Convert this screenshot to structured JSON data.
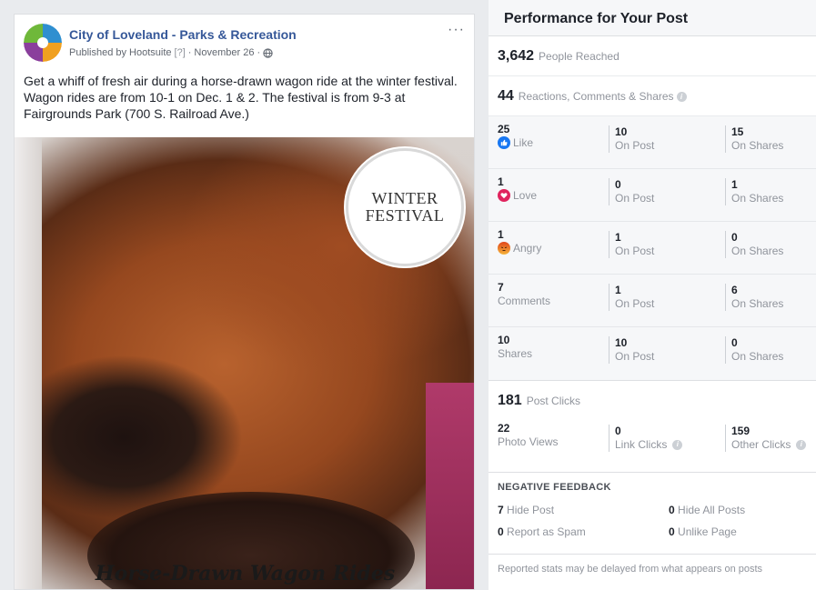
{
  "post": {
    "page_name": "City of Loveland - Parks & Recreation",
    "published_by": "Published by Hootsuite",
    "help_mark": "[?]",
    "date": "November 26",
    "more": "···",
    "text": "Get a whiff of fresh air during a horse-drawn wagon ride at the winter festival. Wagon rides are from 10-1 on Dec. 1 & 2. The festival is from 9-3 at Fairgrounds Park (700 S. Railroad Ave.)",
    "image": {
      "badge_line1": "WINTER",
      "badge_line2": "FESTIVAL",
      "caption": "Horse-Drawn Wagon Rides"
    }
  },
  "panel": {
    "title": "Performance for Your Post",
    "reach": {
      "value": "3,642",
      "label": "People Reached"
    },
    "engagement": {
      "value": "44",
      "label": "Reactions, Comments & Shares"
    },
    "stats": [
      {
        "value": "25",
        "label": "Like",
        "icon": "like-icon",
        "on_post": "10",
        "on_post_label": "On Post",
        "on_shares": "15",
        "on_shares_label": "On Shares"
      },
      {
        "value": "1",
        "label": "Love",
        "icon": "love-icon",
        "on_post": "0",
        "on_post_label": "On Post",
        "on_shares": "1",
        "on_shares_label": "On Shares"
      },
      {
        "value": "1",
        "label": "Angry",
        "icon": "angry-icon",
        "on_post": "1",
        "on_post_label": "On Post",
        "on_shares": "0",
        "on_shares_label": "On Shares"
      },
      {
        "value": "7",
        "label": "Comments",
        "icon": "",
        "on_post": "1",
        "on_post_label": "On Post",
        "on_shares": "6",
        "on_shares_label": "On Shares"
      },
      {
        "value": "10",
        "label": "Shares",
        "icon": "",
        "on_post": "10",
        "on_post_label": "On Post",
        "on_shares": "0",
        "on_shares_label": "On Shares"
      }
    ],
    "clicks": {
      "value": "181",
      "label": "Post Clicks",
      "photo_views": "22",
      "photo_views_label": "Photo Views",
      "link_clicks": "0",
      "link_clicks_label": "Link Clicks",
      "other_clicks": "159",
      "other_clicks_label": "Other Clicks"
    },
    "negative": {
      "title": "NEGATIVE FEEDBACK",
      "hide_post": "7",
      "hide_post_label": "Hide Post",
      "hide_all": "0",
      "hide_all_label": "Hide All Posts",
      "spam": "0",
      "spam_label": "Report as Spam",
      "unlike": "0",
      "unlike_label": "Unlike Page"
    },
    "footnote": "Reported stats may be delayed from what appears on posts"
  },
  "colors": {
    "link": "#365899",
    "like": "#1877f2",
    "love": "#e0245e",
    "angry": "#e9710f",
    "muted": "#90949c"
  }
}
